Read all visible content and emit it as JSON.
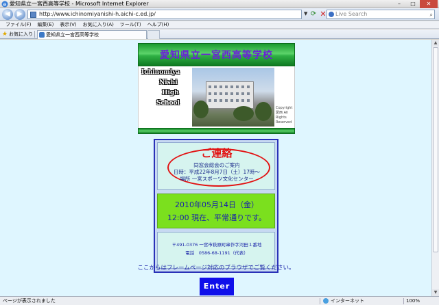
{
  "window": {
    "title": "愛知県立一宮西高等学校 - Microsoft Internet Explorer",
    "minimize": "–",
    "maximize": "□",
    "close": "✕"
  },
  "toolbar": {
    "address": "http://www.ichinomiyanishi-h.aichi-c.ed.jp/",
    "search_placeholder": "Live Search"
  },
  "menu": {
    "items": [
      "ファイル(F)",
      "編集(E)",
      "表示(V)",
      "お気に入り(A)",
      "ツール(T)",
      "ヘルプ(H)"
    ]
  },
  "favorites": {
    "label": "お気に入り",
    "tab_title": "愛知県立一宮西高等学校"
  },
  "page": {
    "header_title": "愛知県立一宮西高等学校",
    "school_name_lines": [
      "Ichinomiya",
      "Nishi",
      "High",
      "School"
    ],
    "photo_copyright": "Copyright 愛西 All Rights Reserved",
    "notice": {
      "title": "ご連絡",
      "line1": "同窓会総会のご案内",
      "line2": "日時：平成22年8月7日（土）17時～",
      "line3": "場所 一宮スポーツ文化センター",
      "date": "2010年05月14日（金）",
      "status": "12:00 現在、平常通りです。",
      "address_line1": "〒491-0376 一宮市萩原町串作字河田１番地",
      "address_line2": "電話　0586-68-1191（代表）"
    },
    "frame_note": "ここからはフレームページ対応のブラウザでご覧ください。",
    "enter_label": "Enter"
  },
  "status": {
    "text": "ページが表示されました",
    "zone": "インターネット",
    "zoom": "100%"
  }
}
